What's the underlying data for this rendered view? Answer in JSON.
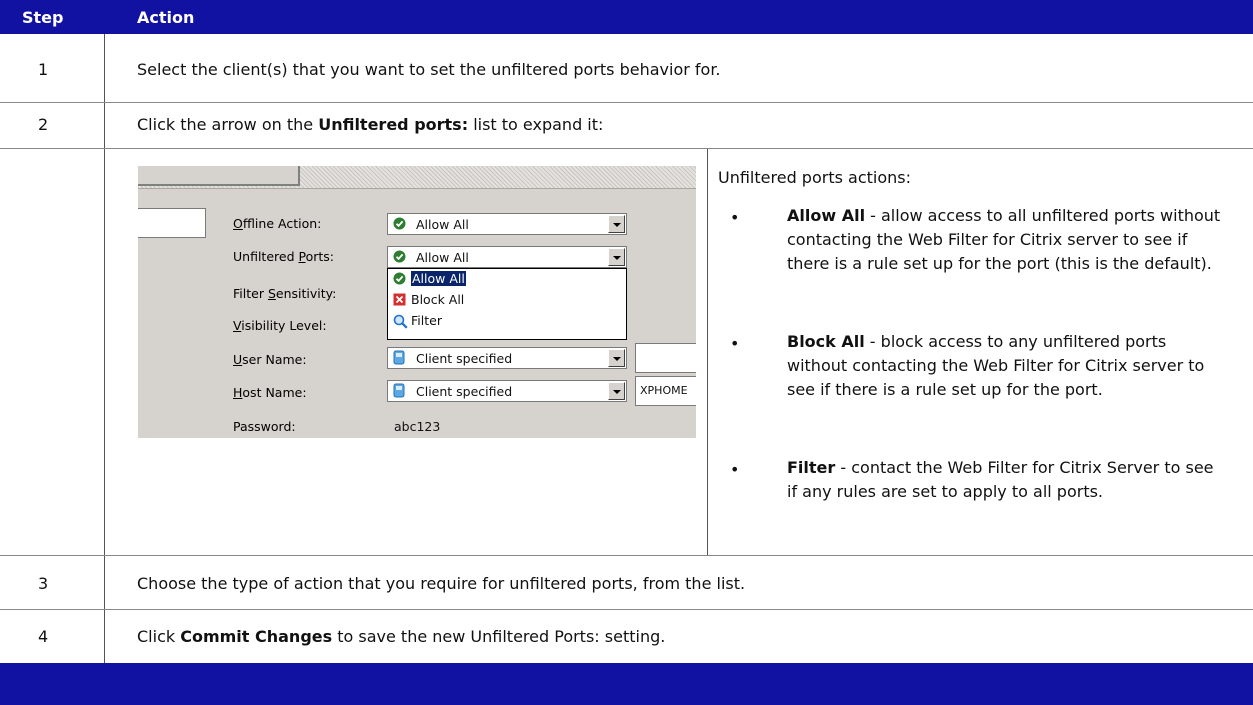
{
  "header": {
    "step": "Step",
    "action": "Action"
  },
  "rows": [
    {
      "step": "1",
      "text": "Select the client(s) that you want to set the unfiltered ports behavior for."
    },
    {
      "step": "2",
      "pre": "Click the arrow on the ",
      "bold": "Unfiltered ports:",
      "post": " list to expand it:"
    },
    {
      "step": "3",
      "text": "Choose the type of action that you require for unfiltered ports, from the list."
    },
    {
      "step": "4",
      "pre": "Click ",
      "bold": "Commit Changes",
      "post": " to save the new Unfiltered Ports: setting."
    }
  ],
  "screenshot": {
    "labels": {
      "offline_action": {
        "pre": "",
        "u": "O",
        "post": "ffline Action:"
      },
      "unfiltered_ports": {
        "pre": "Unfiltered ",
        "u": "P",
        "post": "orts:"
      },
      "filter_sensitivity": {
        "pre": "Filter ",
        "u": "S",
        "post": "ensitivity:"
      },
      "visibility_level": {
        "pre": "",
        "u": "V",
        "post": "isibility Level:"
      },
      "user_name": {
        "pre": "",
        "u": "U",
        "post": "ser Name:"
      },
      "host_name": {
        "pre": "",
        "u": "H",
        "post": "ost Name:"
      },
      "password": "Password:"
    },
    "offline_value": "Allow All",
    "unfiltered_value": "Allow All",
    "dropdown_options": [
      "Allow All",
      "Block All",
      "Filter"
    ],
    "user_name_value": "Client specified",
    "host_name_value": "Client specified",
    "host_side_text": "XPHOME",
    "password_value": "abc123",
    "colors": {
      "check_green": "#2e7d32",
      "block_red": "#d32f2f",
      "selection_blue": "#0a246a"
    }
  },
  "actions_panel": {
    "title": "Unfiltered ports actions:",
    "items": [
      {
        "bold": "Allow All",
        "text": " - allow access to all unfiltered ports without contacting the Web Filter for Citrix server to see if there is a rule set up for the port (this is the default)."
      },
      {
        "bold": "Block All",
        "text": " - block access to any unfiltered ports without contacting the Web Filter for Citrix server to see if there is a rule set up for the port."
      },
      {
        "bold": "Filter",
        "text": " - contact the Web Filter for Citrix Server to see if any rules are set to apply to all ports."
      }
    ]
  },
  "colors": {
    "header_bg": "#1212a2",
    "footer_bg": "#1212a2"
  }
}
